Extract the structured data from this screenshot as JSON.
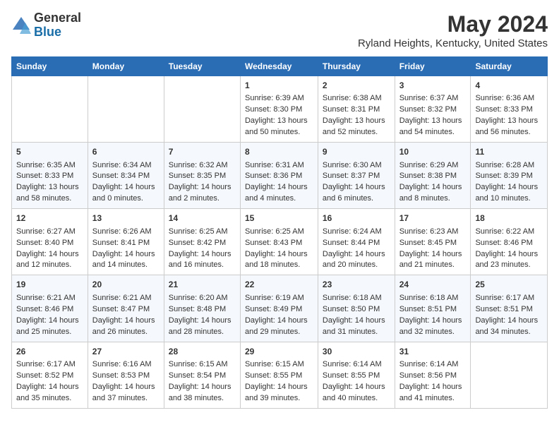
{
  "logo": {
    "general": "General",
    "blue": "Blue"
  },
  "title": "May 2024",
  "subtitle": "Ryland Heights, Kentucky, United States",
  "days_of_week": [
    "Sunday",
    "Monday",
    "Tuesday",
    "Wednesday",
    "Thursday",
    "Friday",
    "Saturday"
  ],
  "weeks": [
    [
      {
        "day": "",
        "content": ""
      },
      {
        "day": "",
        "content": ""
      },
      {
        "day": "",
        "content": ""
      },
      {
        "day": "1",
        "content": "Sunrise: 6:39 AM\nSunset: 8:30 PM\nDaylight: 13 hours\nand 50 minutes."
      },
      {
        "day": "2",
        "content": "Sunrise: 6:38 AM\nSunset: 8:31 PM\nDaylight: 13 hours\nand 52 minutes."
      },
      {
        "day": "3",
        "content": "Sunrise: 6:37 AM\nSunset: 8:32 PM\nDaylight: 13 hours\nand 54 minutes."
      },
      {
        "day": "4",
        "content": "Sunrise: 6:36 AM\nSunset: 8:33 PM\nDaylight: 13 hours\nand 56 minutes."
      }
    ],
    [
      {
        "day": "5",
        "content": "Sunrise: 6:35 AM\nSunset: 8:33 PM\nDaylight: 13 hours\nand 58 minutes."
      },
      {
        "day": "6",
        "content": "Sunrise: 6:34 AM\nSunset: 8:34 PM\nDaylight: 14 hours\nand 0 minutes."
      },
      {
        "day": "7",
        "content": "Sunrise: 6:32 AM\nSunset: 8:35 PM\nDaylight: 14 hours\nand 2 minutes."
      },
      {
        "day": "8",
        "content": "Sunrise: 6:31 AM\nSunset: 8:36 PM\nDaylight: 14 hours\nand 4 minutes."
      },
      {
        "day": "9",
        "content": "Sunrise: 6:30 AM\nSunset: 8:37 PM\nDaylight: 14 hours\nand 6 minutes."
      },
      {
        "day": "10",
        "content": "Sunrise: 6:29 AM\nSunset: 8:38 PM\nDaylight: 14 hours\nand 8 minutes."
      },
      {
        "day": "11",
        "content": "Sunrise: 6:28 AM\nSunset: 8:39 PM\nDaylight: 14 hours\nand 10 minutes."
      }
    ],
    [
      {
        "day": "12",
        "content": "Sunrise: 6:27 AM\nSunset: 8:40 PM\nDaylight: 14 hours\nand 12 minutes."
      },
      {
        "day": "13",
        "content": "Sunrise: 6:26 AM\nSunset: 8:41 PM\nDaylight: 14 hours\nand 14 minutes."
      },
      {
        "day": "14",
        "content": "Sunrise: 6:25 AM\nSunset: 8:42 PM\nDaylight: 14 hours\nand 16 minutes."
      },
      {
        "day": "15",
        "content": "Sunrise: 6:25 AM\nSunset: 8:43 PM\nDaylight: 14 hours\nand 18 minutes."
      },
      {
        "day": "16",
        "content": "Sunrise: 6:24 AM\nSunset: 8:44 PM\nDaylight: 14 hours\nand 20 minutes."
      },
      {
        "day": "17",
        "content": "Sunrise: 6:23 AM\nSunset: 8:45 PM\nDaylight: 14 hours\nand 21 minutes."
      },
      {
        "day": "18",
        "content": "Sunrise: 6:22 AM\nSunset: 8:46 PM\nDaylight: 14 hours\nand 23 minutes."
      }
    ],
    [
      {
        "day": "19",
        "content": "Sunrise: 6:21 AM\nSunset: 8:46 PM\nDaylight: 14 hours\nand 25 minutes."
      },
      {
        "day": "20",
        "content": "Sunrise: 6:21 AM\nSunset: 8:47 PM\nDaylight: 14 hours\nand 26 minutes."
      },
      {
        "day": "21",
        "content": "Sunrise: 6:20 AM\nSunset: 8:48 PM\nDaylight: 14 hours\nand 28 minutes."
      },
      {
        "day": "22",
        "content": "Sunrise: 6:19 AM\nSunset: 8:49 PM\nDaylight: 14 hours\nand 29 minutes."
      },
      {
        "day": "23",
        "content": "Sunrise: 6:18 AM\nSunset: 8:50 PM\nDaylight: 14 hours\nand 31 minutes."
      },
      {
        "day": "24",
        "content": "Sunrise: 6:18 AM\nSunset: 8:51 PM\nDaylight: 14 hours\nand 32 minutes."
      },
      {
        "day": "25",
        "content": "Sunrise: 6:17 AM\nSunset: 8:51 PM\nDaylight: 14 hours\nand 34 minutes."
      }
    ],
    [
      {
        "day": "26",
        "content": "Sunrise: 6:17 AM\nSunset: 8:52 PM\nDaylight: 14 hours\nand 35 minutes."
      },
      {
        "day": "27",
        "content": "Sunrise: 6:16 AM\nSunset: 8:53 PM\nDaylight: 14 hours\nand 37 minutes."
      },
      {
        "day": "28",
        "content": "Sunrise: 6:15 AM\nSunset: 8:54 PM\nDaylight: 14 hours\nand 38 minutes."
      },
      {
        "day": "29",
        "content": "Sunrise: 6:15 AM\nSunset: 8:55 PM\nDaylight: 14 hours\nand 39 minutes."
      },
      {
        "day": "30",
        "content": "Sunrise: 6:14 AM\nSunset: 8:55 PM\nDaylight: 14 hours\nand 40 minutes."
      },
      {
        "day": "31",
        "content": "Sunrise: 6:14 AM\nSunset: 8:56 PM\nDaylight: 14 hours\nand 41 minutes."
      },
      {
        "day": "",
        "content": ""
      }
    ]
  ]
}
